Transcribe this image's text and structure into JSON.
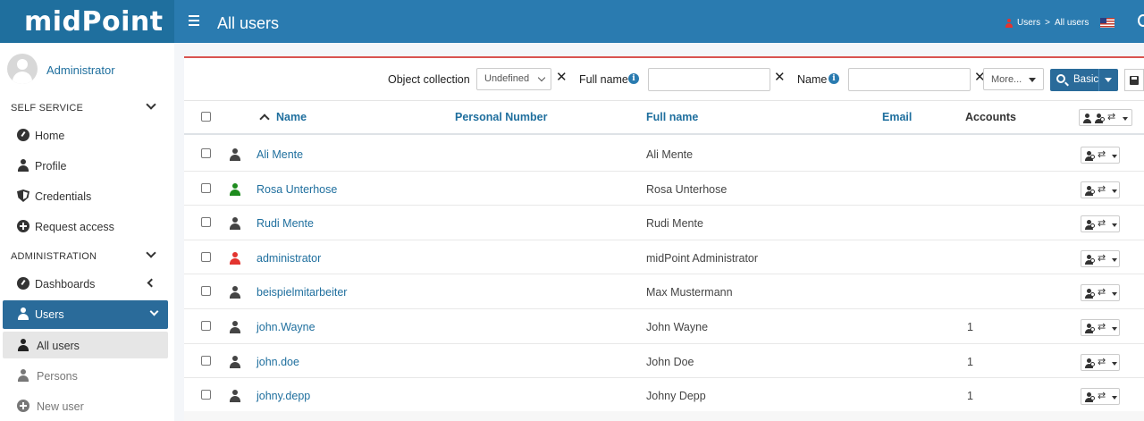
{
  "header": {
    "brand": "midPoint",
    "page_title": "All users",
    "breadcrumb": {
      "users": "Users",
      "separator": ">",
      "current": "All users"
    },
    "icons": [
      "hamburger-icon",
      "user-icon",
      "flag-icon",
      "search-icon"
    ]
  },
  "sidebar": {
    "user_name": "Administrator",
    "sections": {
      "self_service": "SELF SERVICE",
      "administration": "ADMINISTRATION"
    },
    "items": [
      {
        "label": "Home",
        "icon": "dashboard-icon"
      },
      {
        "label": "Profile",
        "icon": "person-icon"
      },
      {
        "label": "Credentials",
        "icon": "shield-icon"
      },
      {
        "label": "Request access",
        "icon": "plus-circle-icon"
      },
      {
        "label": "Dashboards",
        "icon": "dashboard-icon"
      },
      {
        "label": "Users",
        "icon": "person-icon"
      },
      {
        "label": "All users",
        "icon": "person-icon"
      },
      {
        "label": "Persons",
        "icon": "person-icon"
      },
      {
        "label": "New user",
        "icon": "plus-circle-icon"
      }
    ]
  },
  "search": {
    "object_collection_label": "Object collection",
    "object_collection_value": "Undefined",
    "full_name_label": "Full name",
    "name_label": "Name",
    "full_name_value": "",
    "name_value": "",
    "more_label": "More...",
    "basic_label": "Basic",
    "clear_symbol": "✕",
    "info_symbol": "i"
  },
  "table": {
    "columns": {
      "name": "Name",
      "personal_number": "Personal Number",
      "full_name": "Full name",
      "email": "Email",
      "accounts": "Accounts"
    },
    "arrows_symbol": "⇄",
    "rows": [
      {
        "name": "Ali Mente",
        "full_name": "Ali Mente",
        "accounts": "",
        "icon_color": "#444444"
      },
      {
        "name": "Rosa Unterhose",
        "full_name": "Rosa Unterhose",
        "accounts": "",
        "icon_color": "#1e8c1e"
      },
      {
        "name": "Rudi Mente",
        "full_name": "Rudi Mente",
        "accounts": "",
        "icon_color": "#444444"
      },
      {
        "name": "administrator",
        "full_name": "midPoint Administrator",
        "accounts": "",
        "icon_color": "#e3342f"
      },
      {
        "name": "beispielmitarbeiter",
        "full_name": "Max Mustermann",
        "accounts": "",
        "icon_color": "#444444"
      },
      {
        "name": "john.Wayne",
        "full_name": "John Wayne",
        "accounts": "1",
        "icon_color": "#444444"
      },
      {
        "name": "john.doe",
        "full_name": "John Doe",
        "accounts": "1",
        "icon_color": "#444444"
      },
      {
        "name": "johny.depp",
        "full_name": "Johny Depp",
        "accounts": "1",
        "icon_color": "#444444"
      }
    ]
  },
  "colors": {
    "brand": "#1f6f9e",
    "navbar": "#2a7bb0",
    "active_nav": "#2a6b9a",
    "panel_top_border": "#d9534f"
  }
}
